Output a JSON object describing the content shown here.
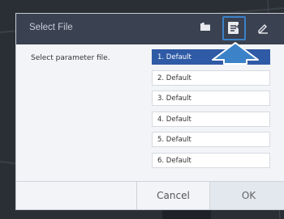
{
  "dialog": {
    "title": "Select File",
    "prompt": "Select parameter file.",
    "files": [
      "1. Default",
      "2. Default",
      "3. Default",
      "4. Default",
      "5. Default",
      "6. Default"
    ],
    "selected_index": 0,
    "cancel_label": "Cancel",
    "ok_label": "OK",
    "header_icons": [
      "folder-icon",
      "load-file-icon",
      "edit-icon"
    ]
  },
  "colors": {
    "header": "#3a4151",
    "selected": "#2f5aa6",
    "highlight": "#3b82c8"
  }
}
